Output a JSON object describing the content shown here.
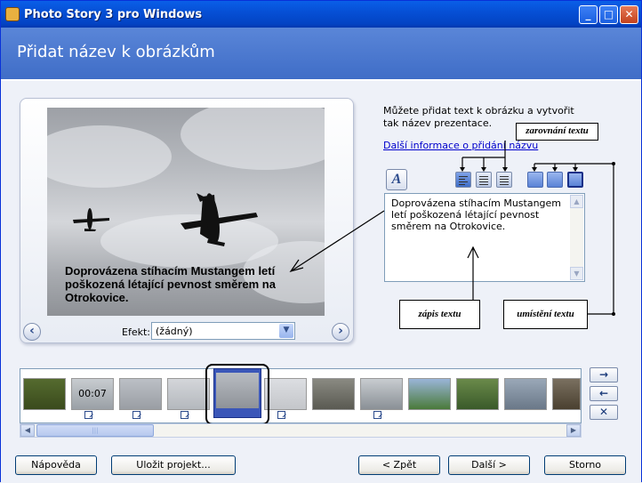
{
  "window": {
    "title": "Photo Story 3 pro Windows",
    "minimize": "_",
    "maximize": "□",
    "close": "✕"
  },
  "header": {
    "title": "Přidat název k obrázkům"
  },
  "preview": {
    "caption": "Doprovázena stíhacím Mustangem letí poškozená létající pevnost směrem na Otrokovice.",
    "prev_icon": "chevron-left-icon",
    "next_icon": "chevron-right-icon"
  },
  "efekt": {
    "label": "Efekt:",
    "value": "(žádný)"
  },
  "info": {
    "text": "Můžete přidat text k obrázku a vytvořit tak název prezentace.",
    "link": "Další informace o přidání názvu"
  },
  "callouts": {
    "alignment": "zarovnání textu",
    "entry": "zápis textu",
    "position": "umístění textu"
  },
  "textbox": {
    "value": "Doprovázena stíhacím Mustangem letí poškozená létající pevnost směrem na Otrokovice."
  },
  "filmstrip": {
    "duration_label": "00:07"
  },
  "side_buttons": {
    "forward": "→",
    "back": "←",
    "remove": "✕"
  },
  "buttons": {
    "help": "Nápověda",
    "save": "Uložit projekt...",
    "back": "< Zpět",
    "next": "Další >",
    "cancel": "Storno"
  }
}
